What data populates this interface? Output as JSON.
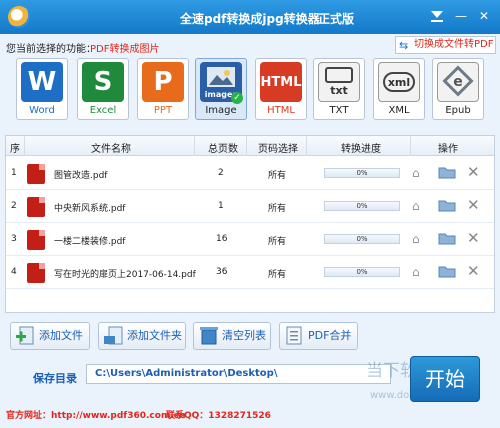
{
  "window": {
    "title": "全速pdf转换成jpg转换器",
    "edition": "正式版"
  },
  "function_row": {
    "label": "您当前选择的功能：",
    "value": "PDF转换成图片",
    "switch_button": "切换成文件转PDF"
  },
  "formats": [
    {
      "label": "Word",
      "icon": "word-icon",
      "color": "#1d6ec4",
      "glyph": "W"
    },
    {
      "label": "Excel",
      "icon": "excel-icon",
      "color": "#1f8a3b",
      "glyph": "S"
    },
    {
      "label": "PPT",
      "icon": "ppt-icon",
      "color": "#e86a1b",
      "glyph": "P"
    },
    {
      "label": "Image",
      "icon": "image-icon",
      "color": "#2b5fa5",
      "glyph": "images",
      "selected": true
    },
    {
      "label": "HTML",
      "icon": "html-icon",
      "color": "#d83b24",
      "glyph": "HTML"
    },
    {
      "label": "TXT",
      "icon": "txt-icon",
      "color": "#f0f0f0",
      "glyph": "txt"
    },
    {
      "label": "XML",
      "icon": "xml-icon",
      "color": "#f0f0f0",
      "glyph": "xml"
    },
    {
      "label": "Epub",
      "icon": "epub-icon",
      "color": "#7f8a95",
      "glyph": "e"
    }
  ],
  "table": {
    "headers": [
      "序",
      "文件名称",
      "总页数",
      "页码选择",
      "转换进度",
      "操作"
    ],
    "rows": [
      {
        "index": "1",
        "name": "图管改造.pdf",
        "pages": "2",
        "range": "所有",
        "progress": "0%"
      },
      {
        "index": "2",
        "name": "中央新风系统.pdf",
        "pages": "1",
        "range": "所有",
        "progress": "0%"
      },
      {
        "index": "3",
        "name": "一楼二楼装修.pdf",
        "pages": "16",
        "range": "所有",
        "progress": "0%"
      },
      {
        "index": "4",
        "name": "写在时光的扉页上2017-06-14.pdf",
        "pages": "36",
        "range": "所有",
        "progress": "0%"
      }
    ]
  },
  "buttons": {
    "add_file": "添加文件",
    "add_folder": "添加文件夹",
    "clear_list": "清空列表",
    "pdf_merge": "PDF合并",
    "start": "开始"
  },
  "save": {
    "label": "保存目录",
    "path": "C:\\Users\\Administrator\\Desktop\\"
  },
  "footer": {
    "site": "官方网址：http://www.pdf360.com.cn",
    "qq": "联系QQ：1328271526"
  },
  "watermark": {
    "line1": "当下软件园",
    "line2": "www.downxia.com"
  }
}
